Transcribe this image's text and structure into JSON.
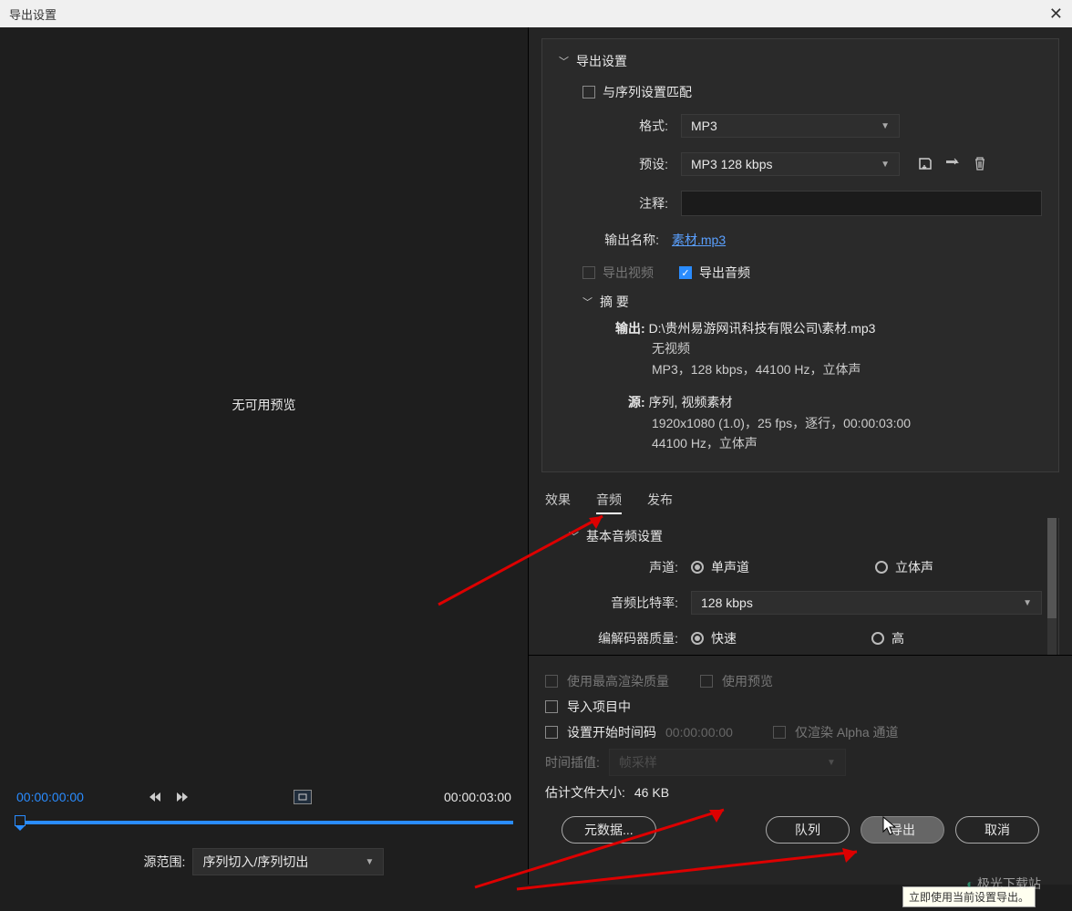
{
  "titlebar": {
    "title": "导出设置"
  },
  "preview": {
    "no_preview": "无可用预览"
  },
  "timecodes": {
    "in": "00:00:00:00",
    "out": "00:00:03:00"
  },
  "range": {
    "label": "源范围:",
    "value": "序列切入/序列切出"
  },
  "export": {
    "section": "导出设置",
    "match": "与序列设置匹配",
    "format_label": "格式:",
    "format_value": "MP3",
    "preset_label": "预设:",
    "preset_value": "MP3 128 kbps",
    "comment_label": "注释:",
    "outname_label": "输出名称:",
    "outname_value": "素材.mp3",
    "export_video": "导出视频",
    "export_audio": "导出音频",
    "summary": "摘 要",
    "out_label": "输出:",
    "out_path": "D:\\贵州易游网讯科技有限公司\\素材.mp3",
    "out_video": "无视频",
    "out_audio": "MP3，128 kbps，44100 Hz，立体声",
    "src_label": "源:",
    "src_line1": "序列, 视频素材",
    "src_line2": "1920x1080 (1.0)，25 fps，逐行，00:00:03:00",
    "src_line3": "44100 Hz，立体声"
  },
  "tabs": {
    "fx": "效果",
    "audio": "音频",
    "publish": "发布"
  },
  "audio": {
    "section": "基本音频设置",
    "channels_label": "声道:",
    "mono": "单声道",
    "stereo": "立体声",
    "bitrate_label": "音频比特率:",
    "bitrate_value": "128 kbps",
    "codec_label": "编解码器质量:",
    "fast": "快速",
    "high": "高"
  },
  "bottom": {
    "max_quality": "使用最高渲染质量",
    "use_preview": "使用预览",
    "import_project": "导入项目中",
    "start_tc": "设置开始时间码",
    "start_tc_value": "00:00:00:00",
    "render_alpha": "仅渲染 Alpha 通道",
    "interp_label": "时间插值:",
    "interp_value": "帧采样",
    "filesize_label": "估计文件大小:",
    "filesize_value": "46 KB",
    "metadata": "元数据...",
    "queue": "队列",
    "export": "导出",
    "cancel": "取消",
    "tooltip": "立即使用当前设置导出。"
  },
  "watermark": "极光下载站"
}
